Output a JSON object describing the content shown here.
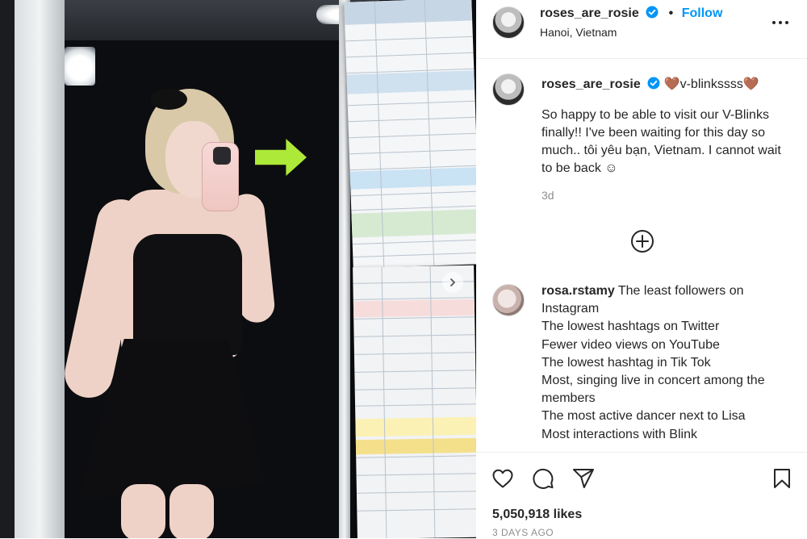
{
  "post": {
    "author": {
      "username": "roses_are_rosie",
      "verified": true,
      "follow_label": "Follow",
      "separator": "•",
      "location": "Hanoi, Vietnam"
    },
    "caption": {
      "username": "roses_are_rosie",
      "title_suffix": "🤎v-blinkssss🤎",
      "body": "So happy to be able to visit our V-Blinks finally!! I've been waiting for this day so much.. tôi yêu bạn, Vietnam. I cannot wait to be back ☺",
      "time_ago": "3d"
    },
    "comments": [
      {
        "username": "rosa.rstamy",
        "lines": [
          "The least followers on Instagram",
          "The lowest hashtags on Twitter",
          "Fewer video views on YouTube",
          "The lowest hashtag in Tik Tok",
          "Most, singing live in concert among the members",
          "The most active dancer next to Lisa",
          "Most interactions with Blink"
        ]
      }
    ],
    "likes": "5,050,918 likes",
    "posted": "3 DAYS AGO"
  },
  "icons": {
    "verified": "verified-badge-icon",
    "more": "more-options-icon",
    "load_more": "plus-circle-icon",
    "like": "heart-icon",
    "comment": "comment-icon",
    "share": "share-icon",
    "save": "bookmark-icon",
    "next": "chevron-right-icon"
  },
  "colors": {
    "accent": "#0095f6",
    "verified": "#0095f6",
    "text": "#262626",
    "muted": "#8e8e8e",
    "sticker": "#b6f53b"
  }
}
